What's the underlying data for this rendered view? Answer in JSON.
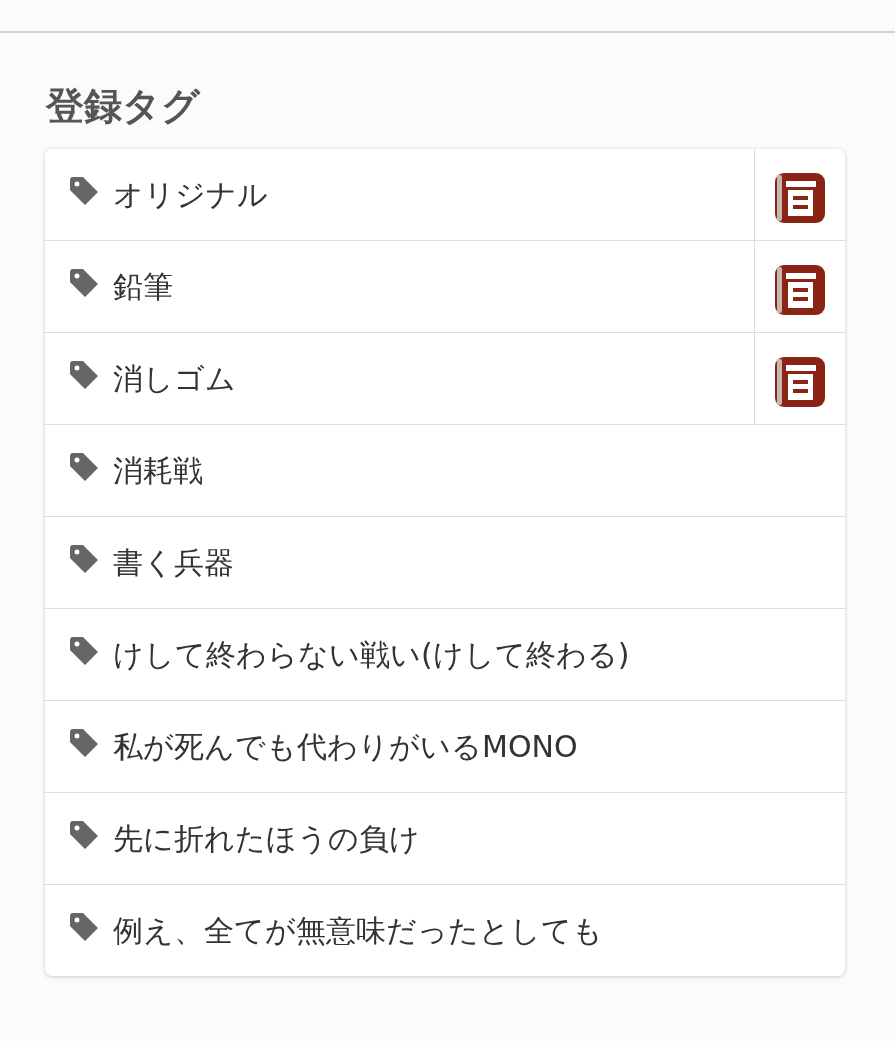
{
  "heading": "登録タグ",
  "tags": [
    {
      "label": "オリジナル",
      "encyclopedia": true
    },
    {
      "label": "鉛筆",
      "encyclopedia": true
    },
    {
      "label": "消しゴム",
      "encyclopedia": true
    },
    {
      "label": "消耗戦",
      "encyclopedia": false
    },
    {
      "label": "書く兵器",
      "encyclopedia": false
    },
    {
      "label": "けして終わらない戦い(けして終わる)",
      "encyclopedia": false
    },
    {
      "label": "私が死んでも代わりがいるMONO",
      "encyclopedia": false
    },
    {
      "label": "先に折れたほうの負け",
      "encyclopedia": false
    },
    {
      "label": "例え、全てが無意味だったとしても",
      "encyclopedia": false
    }
  ]
}
